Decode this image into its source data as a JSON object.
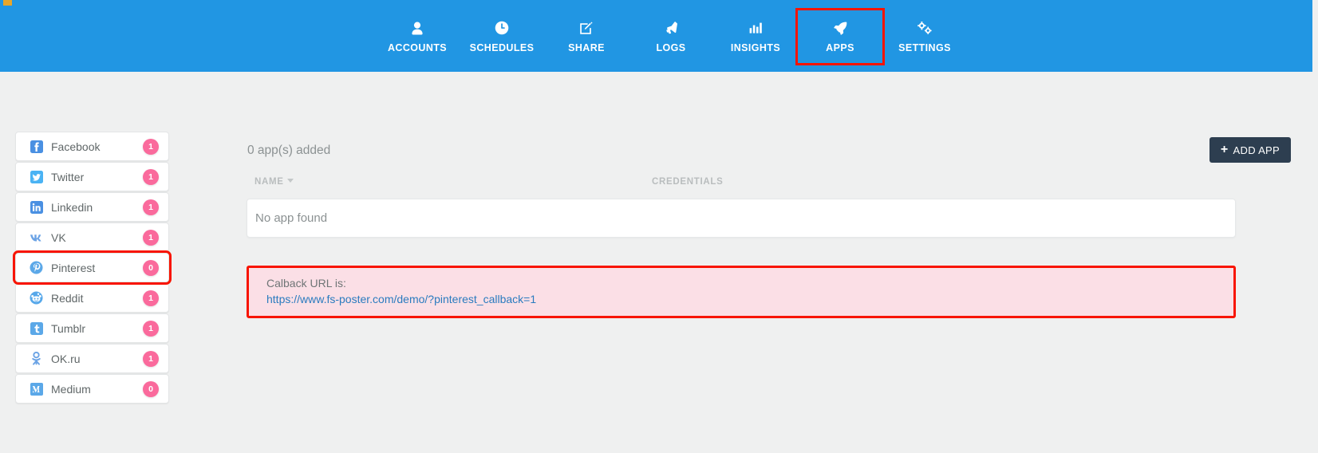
{
  "nav": {
    "items": [
      {
        "label": "ACCOUNTS",
        "icon": "user-icon",
        "active": false
      },
      {
        "label": "SCHEDULES",
        "icon": "clock-icon",
        "active": false
      },
      {
        "label": "SHARE",
        "icon": "compose-icon",
        "active": false
      },
      {
        "label": "LOGS",
        "icon": "megaphone-icon",
        "active": false
      },
      {
        "label": "INSIGHTS",
        "icon": "chart-icon",
        "active": false
      },
      {
        "label": "APPS",
        "icon": "rocket-icon",
        "active": true
      },
      {
        "label": "SETTINGS",
        "icon": "gears-icon",
        "active": false
      }
    ]
  },
  "sidebar": {
    "items": [
      {
        "label": "Facebook",
        "badge": "1",
        "icon": "facebook-icon",
        "active": false
      },
      {
        "label": "Twitter",
        "badge": "1",
        "icon": "twitter-icon",
        "active": false
      },
      {
        "label": "Linkedin",
        "badge": "1",
        "icon": "linkedin-icon",
        "active": false
      },
      {
        "label": "VK",
        "badge": "1",
        "icon": "vk-icon",
        "active": false
      },
      {
        "label": "Pinterest",
        "badge": "0",
        "icon": "pinterest-icon",
        "active": true
      },
      {
        "label": "Reddit",
        "badge": "1",
        "icon": "reddit-icon",
        "active": false
      },
      {
        "label": "Tumblr",
        "badge": "1",
        "icon": "tumblr-icon",
        "active": false
      },
      {
        "label": "OK.ru",
        "badge": "1",
        "icon": "okru-icon",
        "active": false
      },
      {
        "label": "Medium",
        "badge": "0",
        "icon": "medium-icon",
        "active": false
      }
    ]
  },
  "main": {
    "apps_count_text": "0 app(s) added",
    "add_app_label": "ADD APP",
    "add_app_plus": "+",
    "table": {
      "col_name": "NAME",
      "col_credentials": "CREDENTIALS",
      "empty_text": "No app found"
    },
    "callback": {
      "label": "Calback URL is:",
      "url": "https://www.fs-poster.com/demo/?pinterest_callback=1"
    }
  },
  "colors": {
    "header_blue": "#2196e3",
    "page_bg": "#eff0f0",
    "badge_pink": "#fa6a9c",
    "highlight_red": "#f81400",
    "callback_bg": "#fbdfe6",
    "add_app_navy": "#2d3e50",
    "link_blue": "#2a7bbf"
  }
}
